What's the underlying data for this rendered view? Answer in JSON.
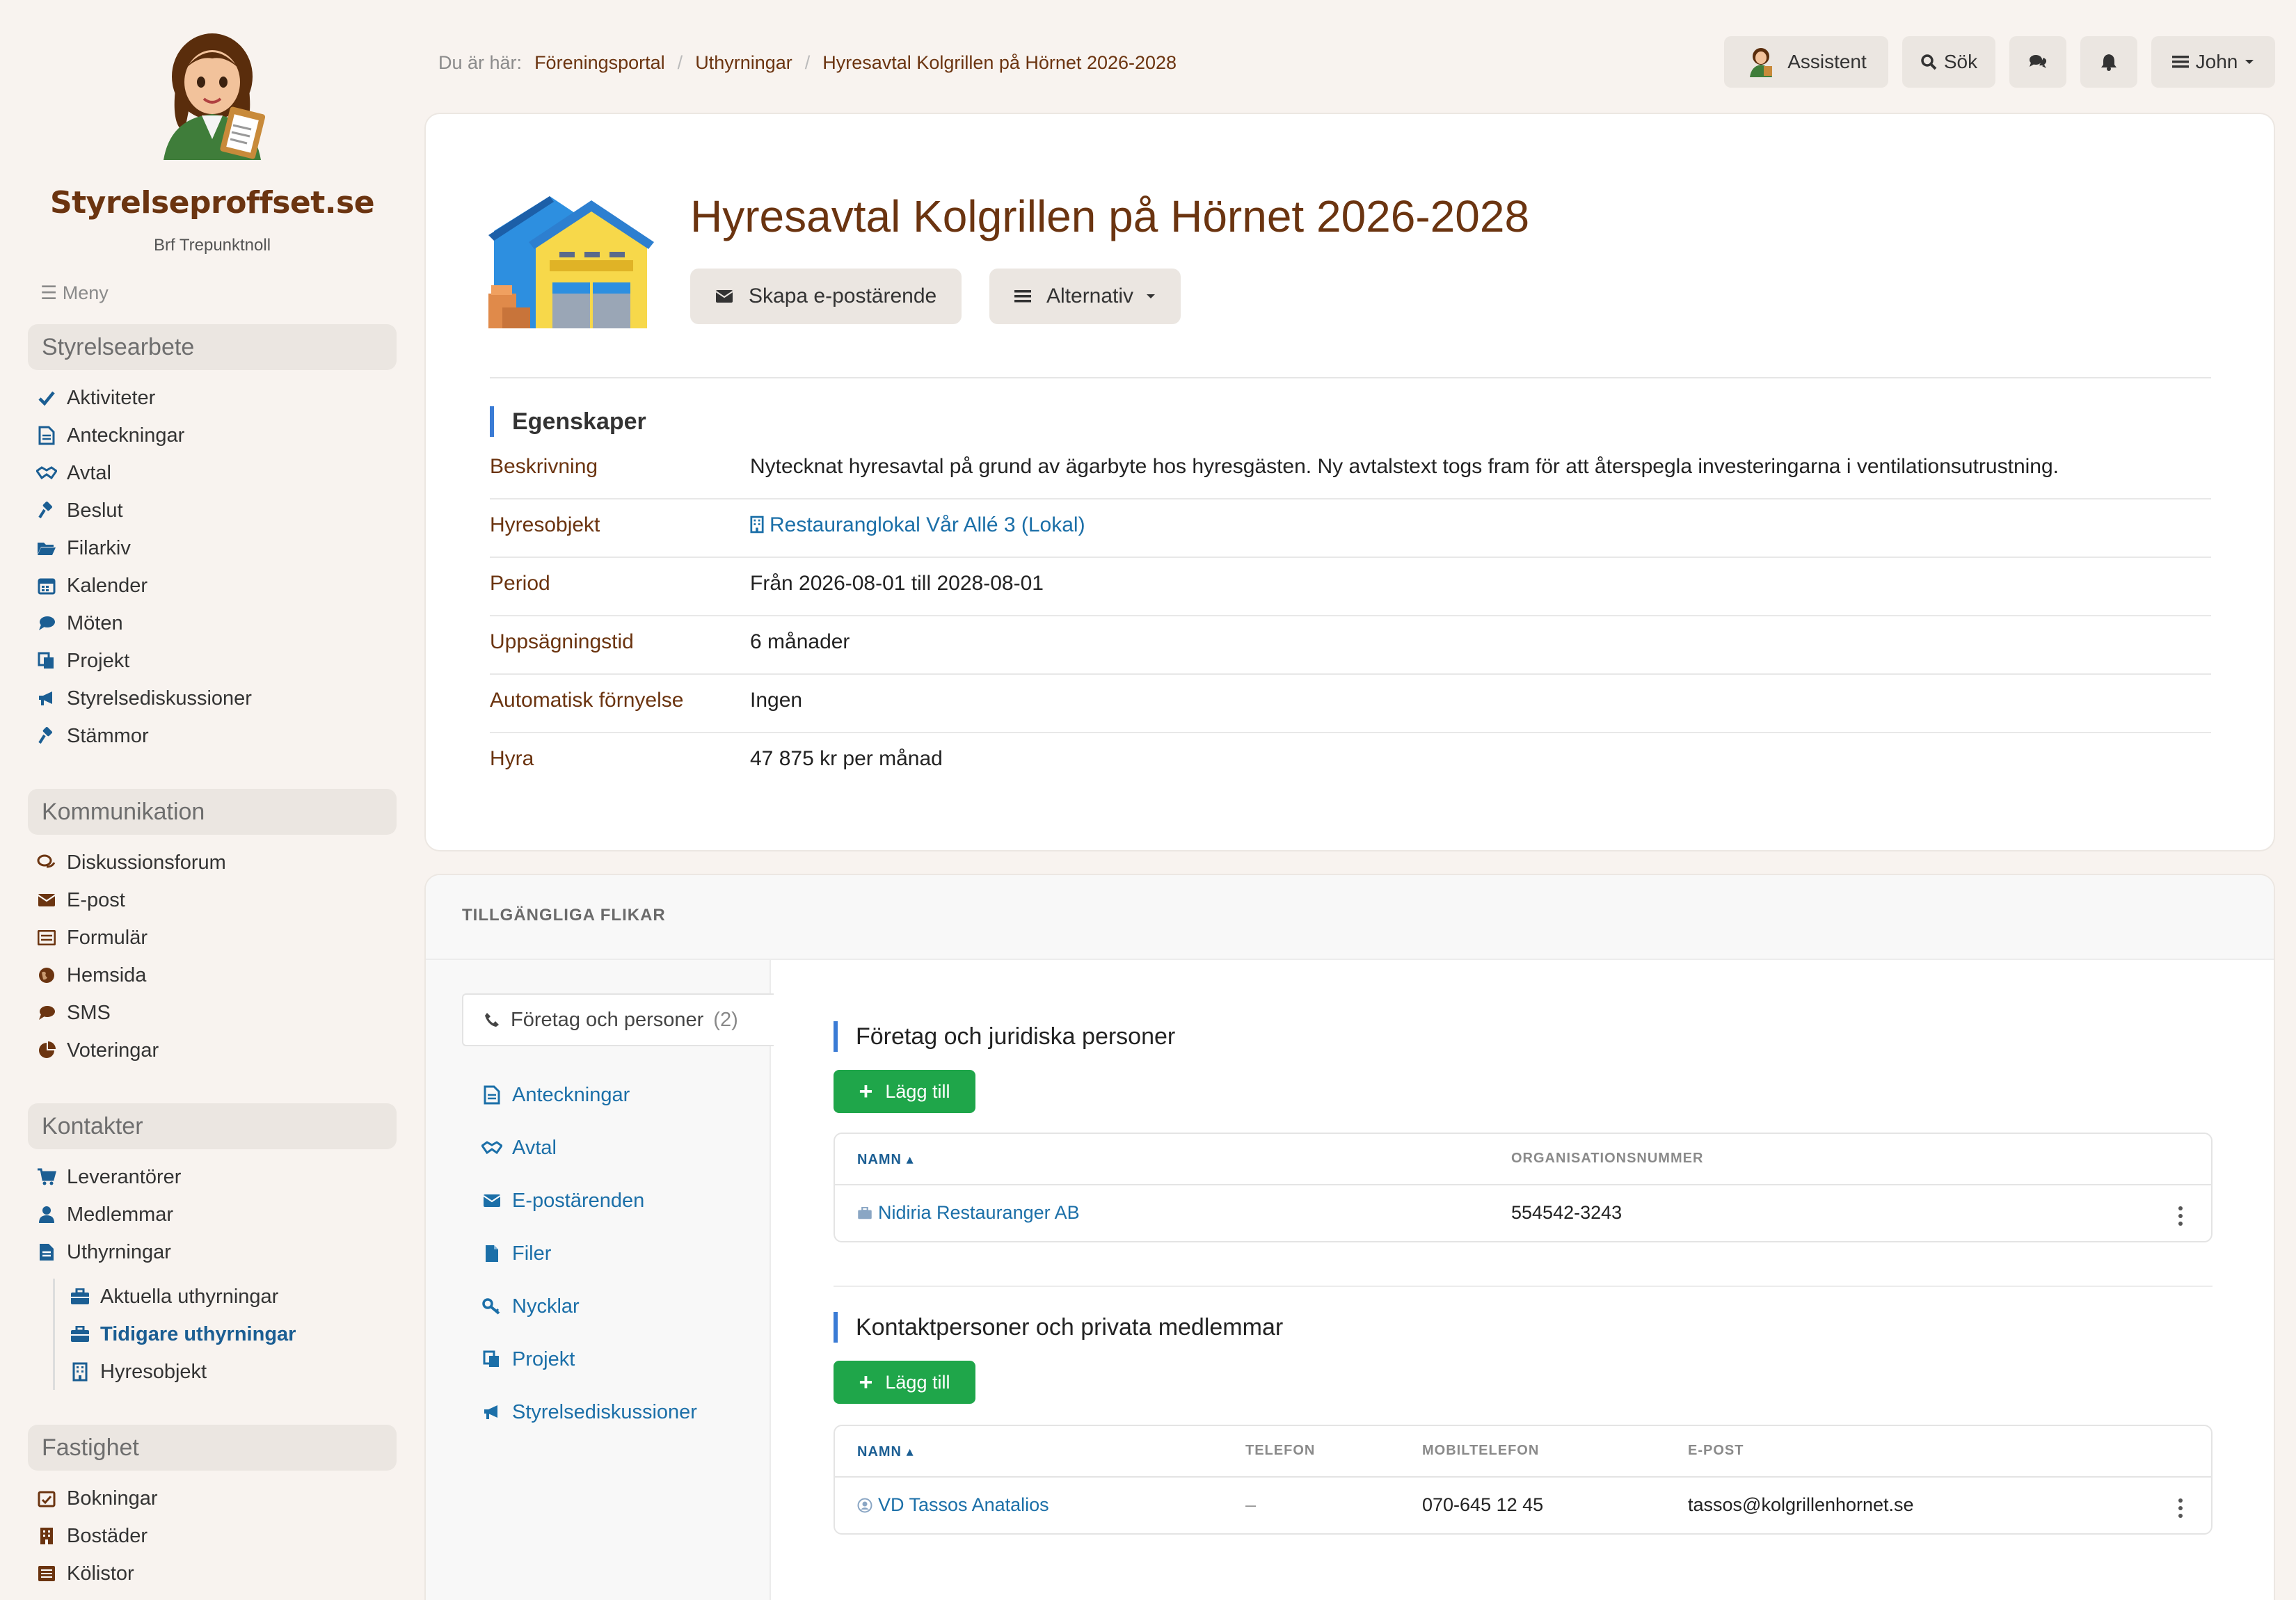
{
  "brand": {
    "name": "Styrelseproffset.se",
    "organization": "Brf Trepunktnoll"
  },
  "menu_label": "Meny",
  "sidebar": {
    "sections": [
      {
        "title": "Styrelsearbete",
        "items": [
          {
            "label": "Aktiviteter",
            "icon": "check-icon"
          },
          {
            "label": "Anteckningar",
            "icon": "document-icon"
          },
          {
            "label": "Avtal",
            "icon": "handshake-icon"
          },
          {
            "label": "Beslut",
            "icon": "gavel-icon"
          },
          {
            "label": "Filarkiv",
            "icon": "folder-open-icon"
          },
          {
            "label": "Kalender",
            "icon": "calendar-icon"
          },
          {
            "label": "Möten",
            "icon": "chat-bubble-icon"
          },
          {
            "label": "Projekt",
            "icon": "copy-icon"
          },
          {
            "label": "Styrelsediskussioner",
            "icon": "megaphone-icon"
          },
          {
            "label": "Stämmor",
            "icon": "gavel-icon"
          }
        ]
      },
      {
        "title": "Kommunikation",
        "items": [
          {
            "label": "Diskussionsforum",
            "icon": "comments-icon"
          },
          {
            "label": "E-post",
            "icon": "envelope-icon"
          },
          {
            "label": "Formulär",
            "icon": "form-icon"
          },
          {
            "label": "Hemsida",
            "icon": "globe-icon"
          },
          {
            "label": "SMS",
            "icon": "chat-bubble-icon"
          },
          {
            "label": "Voteringar",
            "icon": "pie-chart-icon"
          }
        ]
      },
      {
        "title": "Kontakter",
        "items": [
          {
            "label": "Leverantörer",
            "icon": "cart-icon"
          },
          {
            "label": "Medlemmar",
            "icon": "user-icon"
          },
          {
            "label": "Uthyrningar",
            "icon": "document-icon"
          }
        ],
        "subitems": [
          {
            "label": "Aktuella uthyrningar",
            "icon": "briefcase-icon"
          },
          {
            "label": "Tidigare uthyrningar",
            "icon": "briefcase-icon",
            "active": true
          },
          {
            "label": "Hyresobjekt",
            "icon": "building-icon"
          }
        ]
      },
      {
        "title": "Fastighet",
        "items": [
          {
            "label": "Bokningar",
            "icon": "calendar-check-icon"
          },
          {
            "label": "Bostäder",
            "icon": "building-icon"
          },
          {
            "label": "Kölistor",
            "icon": "list-icon"
          }
        ]
      }
    ]
  },
  "breadcrumb": {
    "prefix": "Du är här:",
    "items": [
      "Föreningsportal",
      "Uthyrningar",
      "Hyresavtal Kolgrillen på Hörnet 2026-2028"
    ]
  },
  "topbar": {
    "assistant_label": "Assistent",
    "search_label": "Sök",
    "user_label": "John"
  },
  "page": {
    "title": "Hyresavtal Kolgrillen på Hörnet 2026-2028",
    "email_button": "Skapa e-postärende",
    "options_button": "Alternativ"
  },
  "properties": {
    "heading": "Egenskaper",
    "rows": [
      {
        "label": "Beskrivning",
        "value": "Nytecknat hyresavtal på grund av ägarbyte hos hyresgästen. Ny avtalstext togs fram för att återspegla investeringarna i ventilationsutrustning."
      },
      {
        "label": "Hyresobjekt",
        "value": "Restauranglokal Vår Allé 3 (Lokal)"
      },
      {
        "label": "Period",
        "value": "Från 2026-08-01 till 2028-08-01"
      },
      {
        "label": "Uppsägningstid",
        "value": "6 månader"
      },
      {
        "label": "Automatisk förnyelse",
        "value": "Ingen"
      },
      {
        "label": "Hyra",
        "value": "47 875 kr per månad"
      }
    ]
  },
  "tabs": {
    "header": "TILLGÄNGLIGA FLIKAR",
    "active": {
      "label": "Företag och personer",
      "count": "(2)"
    },
    "items": [
      {
        "label": "Anteckningar",
        "icon": "document-icon"
      },
      {
        "label": "Avtal",
        "icon": "handshake-icon"
      },
      {
        "label": "E-postärenden",
        "icon": "envelope-icon"
      },
      {
        "label": "Filer",
        "icon": "file-icon"
      },
      {
        "label": "Nycklar",
        "icon": "key-icon"
      },
      {
        "label": "Projekt",
        "icon": "copy-icon"
      },
      {
        "label": "Styrelsediskussioner",
        "icon": "megaphone-icon"
      }
    ]
  },
  "companies": {
    "heading": "Företag och juridiska personer",
    "add_label": "Lägg till",
    "columns": [
      "NAMN",
      "ORGANISATIONSNUMMER"
    ],
    "rows": [
      {
        "name": "Nidiria Restauranger AB",
        "org_number": "554542-3243"
      }
    ]
  },
  "contacts": {
    "heading": "Kontaktpersoner och privata medlemmar",
    "add_label": "Lägg till",
    "columns": [
      "NAMN",
      "TELEFON",
      "MOBILTELEFON",
      "E-POST"
    ],
    "rows": [
      {
        "name": "VD Tassos Anatalios",
        "phone": "–",
        "mobile": "070-645 12 45",
        "email": "tassos@kolgrillenhornet.se"
      }
    ]
  },
  "colors": {
    "brand_brown": "#6b3410",
    "link_blue": "#1b6fa8",
    "accent_blue": "#3a7bd5",
    "add_green": "#1fa64a",
    "background": "#f8f3ef"
  }
}
